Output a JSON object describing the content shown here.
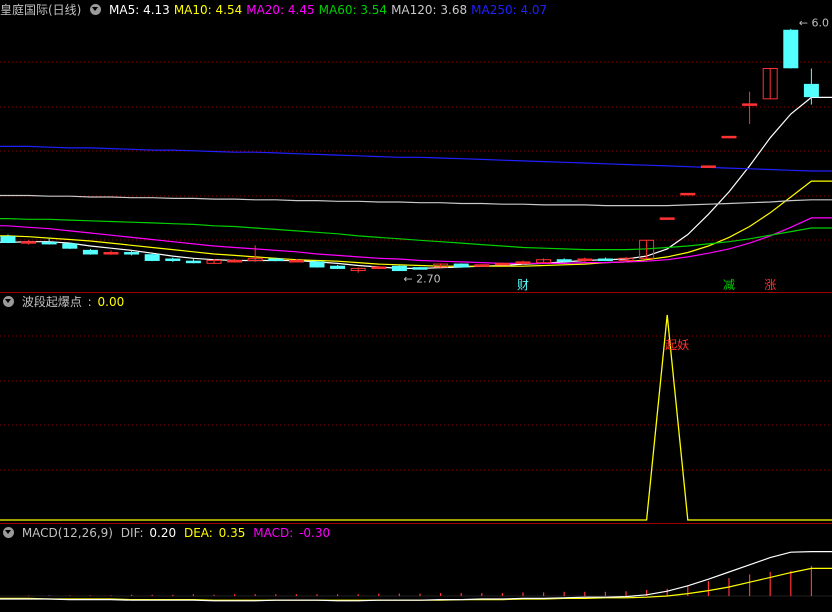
{
  "title": "皇庭国际(日线)",
  "colors": {
    "ma5": "#ffffff",
    "ma10": "#ffff00",
    "ma20": "#ff00ff",
    "ma60": "#00d000",
    "ma120": "#c8c8c8",
    "ma250": "#2020ff",
    "up": "#ff3232",
    "down": "#54ffff",
    "grid": "#8b0000",
    "indicator": "#ffff00",
    "macd_dif": "#ffffff",
    "macd_dea": "#ffff00",
    "macd_bar_up": "#ff3232"
  },
  "ma_legend": [
    {
      "label": "MA5:",
      "value": "4.13",
      "color": "#ffffff"
    },
    {
      "label": "MA10:",
      "value": "4.54",
      "color": "#ffff00"
    },
    {
      "label": "MA20:",
      "value": "4.45",
      "color": "#ff00ff"
    },
    {
      "label": "MA60:",
      "value": "3.54",
      "color": "#00d000"
    },
    {
      "label": "MA120:",
      "value": "3.68",
      "color": "#c8c8c8"
    },
    {
      "label": "MA250:",
      "value": "4.07",
      "color": "#2020ff"
    }
  ],
  "price_panel": {
    "low_label": "2.70",
    "high_label": "6.0",
    "markers": [
      {
        "text": "财",
        "color": "#54ffff"
      },
      {
        "text": "减",
        "color": "#00d000"
      },
      {
        "text": "涨",
        "color": "#ff3232"
      }
    ]
  },
  "indicator_panel": {
    "name": "波段起爆点",
    "value_label": ":",
    "value": "0.00",
    "signal_text": "起妖"
  },
  "macd_panel": {
    "name": "MACD(12,26,9)",
    "dif_label": "DIF:",
    "dif": "0.20",
    "dea_label": "DEA:",
    "dea": "0.35",
    "macd_label": "MACD:",
    "macd": "-0.30"
  },
  "chart_data": {
    "type": "candlestick",
    "price_range": [
      2.5,
      6.2
    ],
    "candles": [
      {
        "o": 3.17,
        "c": 3.09,
        "h": 3.2,
        "l": 3.08
      },
      {
        "o": 3.08,
        "c": 3.1,
        "h": 3.12,
        "l": 3.06
      },
      {
        "o": 3.09,
        "c": 3.08,
        "h": 3.14,
        "l": 3.06
      },
      {
        "o": 3.07,
        "c": 3.01,
        "h": 3.09,
        "l": 3.0
      },
      {
        "o": 2.98,
        "c": 2.93,
        "h": 3.0,
        "l": 2.92
      },
      {
        "o": 2.93,
        "c": 2.95,
        "h": 2.98,
        "l": 2.92
      },
      {
        "o": 2.95,
        "c": 2.93,
        "h": 2.98,
        "l": 2.91
      },
      {
        "o": 2.92,
        "c": 2.84,
        "h": 2.94,
        "l": 2.83
      },
      {
        "o": 2.86,
        "c": 2.84,
        "h": 2.88,
        "l": 2.82
      },
      {
        "o": 2.83,
        "c": 2.81,
        "h": 2.86,
        "l": 2.8
      },
      {
        "o": 2.8,
        "c": 2.84,
        "h": 2.86,
        "l": 2.79
      },
      {
        "o": 2.82,
        "c": 2.84,
        "h": 2.86,
        "l": 2.81
      },
      {
        "o": 2.84,
        "c": 2.87,
        "h": 3.05,
        "l": 2.82
      },
      {
        "o": 2.86,
        "c": 2.84,
        "h": 2.88,
        "l": 2.83
      },
      {
        "o": 2.84,
        "c": 2.84,
        "h": 2.86,
        "l": 2.82
      },
      {
        "o": 2.82,
        "c": 2.75,
        "h": 2.84,
        "l": 2.74
      },
      {
        "o": 2.76,
        "c": 2.73,
        "h": 2.78,
        "l": 2.72
      },
      {
        "o": 2.7,
        "c": 2.73,
        "h": 2.74,
        "l": 2.67
      },
      {
        "o": 2.73,
        "c": 2.75,
        "h": 2.76,
        "l": 2.72
      },
      {
        "o": 2.76,
        "c": 2.7,
        "h": 2.77,
        "l": 2.7
      },
      {
        "o": 2.74,
        "c": 2.73,
        "h": 2.75,
        "l": 2.72
      },
      {
        "o": 2.75,
        "c": 2.79,
        "h": 2.8,
        "l": 2.74
      },
      {
        "o": 2.79,
        "c": 2.75,
        "h": 2.8,
        "l": 2.74
      },
      {
        "o": 2.76,
        "c": 2.78,
        "h": 2.79,
        "l": 2.75
      },
      {
        "o": 2.78,
        "c": 2.8,
        "h": 2.81,
        "l": 2.77
      },
      {
        "o": 2.8,
        "c": 2.82,
        "h": 2.84,
        "l": 2.78
      },
      {
        "o": 2.81,
        "c": 2.85,
        "h": 2.87,
        "l": 2.8
      },
      {
        "o": 2.85,
        "c": 2.83,
        "h": 2.87,
        "l": 2.82
      },
      {
        "o": 2.84,
        "c": 2.86,
        "h": 2.88,
        "l": 2.82
      },
      {
        "o": 2.86,
        "c": 2.84,
        "h": 2.88,
        "l": 2.83
      },
      {
        "o": 2.84,
        "c": 2.87,
        "h": 2.89,
        "l": 2.83
      },
      {
        "o": 2.87,
        "c": 3.12,
        "h": 3.12,
        "l": 2.86
      },
      {
        "o": 3.43,
        "c": 3.43,
        "h": 3.43,
        "l": 3.43
      },
      {
        "o": 3.77,
        "c": 3.77,
        "h": 3.77,
        "l": 3.77
      },
      {
        "o": 4.15,
        "c": 4.15,
        "h": 4.15,
        "l": 4.15
      },
      {
        "o": 4.56,
        "c": 4.56,
        "h": 4.56,
        "l": 4.56
      },
      {
        "o": 5.01,
        "c": 5.01,
        "h": 5.18,
        "l": 4.73
      },
      {
        "o": 5.08,
        "c": 5.5,
        "h": 5.5,
        "l": 5.08
      },
      {
        "o": 6.03,
        "c": 5.51,
        "h": 6.05,
        "l": 5.5
      },
      {
        "o": 5.28,
        "c": 5.11,
        "h": 5.5,
        "l": 5.0
      }
    ],
    "moving_averages": [
      {
        "name": "MA5",
        "values": [
          3.09,
          3.1,
          3.1,
          3.08,
          3.04,
          3.01,
          2.98,
          2.94,
          2.9,
          2.87,
          2.85,
          2.84,
          2.84,
          2.84,
          2.84,
          2.82,
          2.8,
          2.77,
          2.75,
          2.73,
          2.73,
          2.74,
          2.75,
          2.76,
          2.77,
          2.79,
          2.8,
          2.82,
          2.84,
          2.85,
          2.86,
          2.9,
          3.0,
          3.2,
          3.48,
          3.79,
          4.15,
          4.54,
          4.87,
          5.1
        ]
      },
      {
        "name": "MA10",
        "values": [
          3.18,
          3.17,
          3.15,
          3.13,
          3.11,
          3.08,
          3.05,
          3.02,
          2.99,
          2.96,
          2.93,
          2.91,
          2.89,
          2.87,
          2.85,
          2.84,
          2.83,
          2.81,
          2.79,
          2.78,
          2.77,
          2.76,
          2.76,
          2.76,
          2.76,
          2.76,
          2.77,
          2.78,
          2.79,
          2.81,
          2.82,
          2.85,
          2.89,
          2.95,
          3.04,
          3.16,
          3.31,
          3.5,
          3.72,
          3.94
        ]
      },
      {
        "name": "MA20",
        "values": [
          3.32,
          3.3,
          3.28,
          3.25,
          3.22,
          3.19,
          3.16,
          3.13,
          3.1,
          3.07,
          3.04,
          3.02,
          3.0,
          2.98,
          2.96,
          2.93,
          2.91,
          2.89,
          2.87,
          2.86,
          2.84,
          2.83,
          2.82,
          2.81,
          2.8,
          2.8,
          2.8,
          2.8,
          2.81,
          2.81,
          2.82,
          2.83,
          2.85,
          2.89,
          2.94,
          3.0,
          3.08,
          3.18,
          3.3,
          3.43
        ]
      },
      {
        "name": "MA60",
        "values": [
          3.42,
          3.41,
          3.41,
          3.4,
          3.39,
          3.38,
          3.37,
          3.36,
          3.35,
          3.34,
          3.32,
          3.31,
          3.29,
          3.27,
          3.25,
          3.23,
          3.21,
          3.18,
          3.16,
          3.14,
          3.12,
          3.1,
          3.08,
          3.06,
          3.04,
          3.02,
          3.01,
          3.0,
          2.99,
          2.99,
          2.99,
          3.0,
          3.02,
          3.04,
          3.07,
          3.1,
          3.14,
          3.19,
          3.24,
          3.29
        ]
      },
      {
        "name": "MA120",
        "values": [
          3.74,
          3.74,
          3.73,
          3.73,
          3.72,
          3.72,
          3.71,
          3.71,
          3.7,
          3.7,
          3.69,
          3.69,
          3.68,
          3.68,
          3.67,
          3.67,
          3.66,
          3.66,
          3.65,
          3.65,
          3.64,
          3.64,
          3.63,
          3.63,
          3.62,
          3.62,
          3.61,
          3.61,
          3.61,
          3.6,
          3.6,
          3.6,
          3.6,
          3.61,
          3.62,
          3.63,
          3.64,
          3.65,
          3.67,
          3.68
        ]
      },
      {
        "name": "MA250",
        "values": [
          4.42,
          4.42,
          4.41,
          4.4,
          4.4,
          4.39,
          4.38,
          4.37,
          4.37,
          4.36,
          4.35,
          4.34,
          4.34,
          4.33,
          4.32,
          4.31,
          4.3,
          4.29,
          4.28,
          4.27,
          4.27,
          4.26,
          4.25,
          4.24,
          4.23,
          4.22,
          4.21,
          4.2,
          4.19,
          4.18,
          4.17,
          4.16,
          4.15,
          4.14,
          4.13,
          4.12,
          4.11,
          4.1,
          4.09,
          4.08
        ]
      }
    ],
    "indicator_values": [
      0,
      0,
      0,
      0,
      0,
      0,
      0,
      0,
      0,
      0,
      0,
      0,
      0,
      0,
      0,
      0,
      0,
      0,
      0,
      0,
      0,
      0,
      0,
      0,
      0,
      0,
      0,
      0,
      0,
      0,
      0,
      0,
      1,
      0,
      0,
      0,
      0,
      0,
      0,
      0
    ],
    "macd": {
      "dif": [
        -0.05,
        -0.05,
        -0.05,
        -0.06,
        -0.06,
        -0.06,
        -0.07,
        -0.07,
        -0.07,
        -0.07,
        -0.08,
        -0.08,
        -0.08,
        -0.07,
        -0.07,
        -0.07,
        -0.08,
        -0.08,
        -0.07,
        -0.07,
        -0.07,
        -0.06,
        -0.06,
        -0.05,
        -0.05,
        -0.04,
        -0.04,
        -0.03,
        -0.02,
        -0.02,
        -0.01,
        0.02,
        0.08,
        0.17,
        0.28,
        0.4,
        0.52,
        0.64,
        0.73,
        0.74
      ],
      "dea": [
        -0.04,
        -0.04,
        -0.05,
        -0.05,
        -0.05,
        -0.05,
        -0.06,
        -0.06,
        -0.06,
        -0.06,
        -0.07,
        -0.07,
        -0.07,
        -0.07,
        -0.07,
        -0.07,
        -0.07,
        -0.07,
        -0.07,
        -0.07,
        -0.07,
        -0.07,
        -0.06,
        -0.06,
        -0.06,
        -0.05,
        -0.05,
        -0.04,
        -0.04,
        -0.03,
        -0.03,
        -0.02,
        0.0,
        0.04,
        0.09,
        0.15,
        0.23,
        0.31,
        0.39,
        0.46
      ],
      "hist": [
        0.0,
        0.01,
        0.01,
        0.01,
        0.01,
        0.01,
        0.02,
        0.02,
        0.02,
        0.03,
        0.02,
        0.03,
        0.03,
        0.03,
        0.03,
        0.03,
        0.03,
        0.03,
        0.04,
        0.04,
        0.04,
        0.05,
        0.05,
        0.05,
        0.05,
        0.06,
        0.06,
        0.07,
        0.07,
        0.07,
        0.08,
        0.1,
        0.12,
        0.18,
        0.25,
        0.3,
        0.36,
        0.4,
        0.42,
        0.5
      ]
    }
  }
}
